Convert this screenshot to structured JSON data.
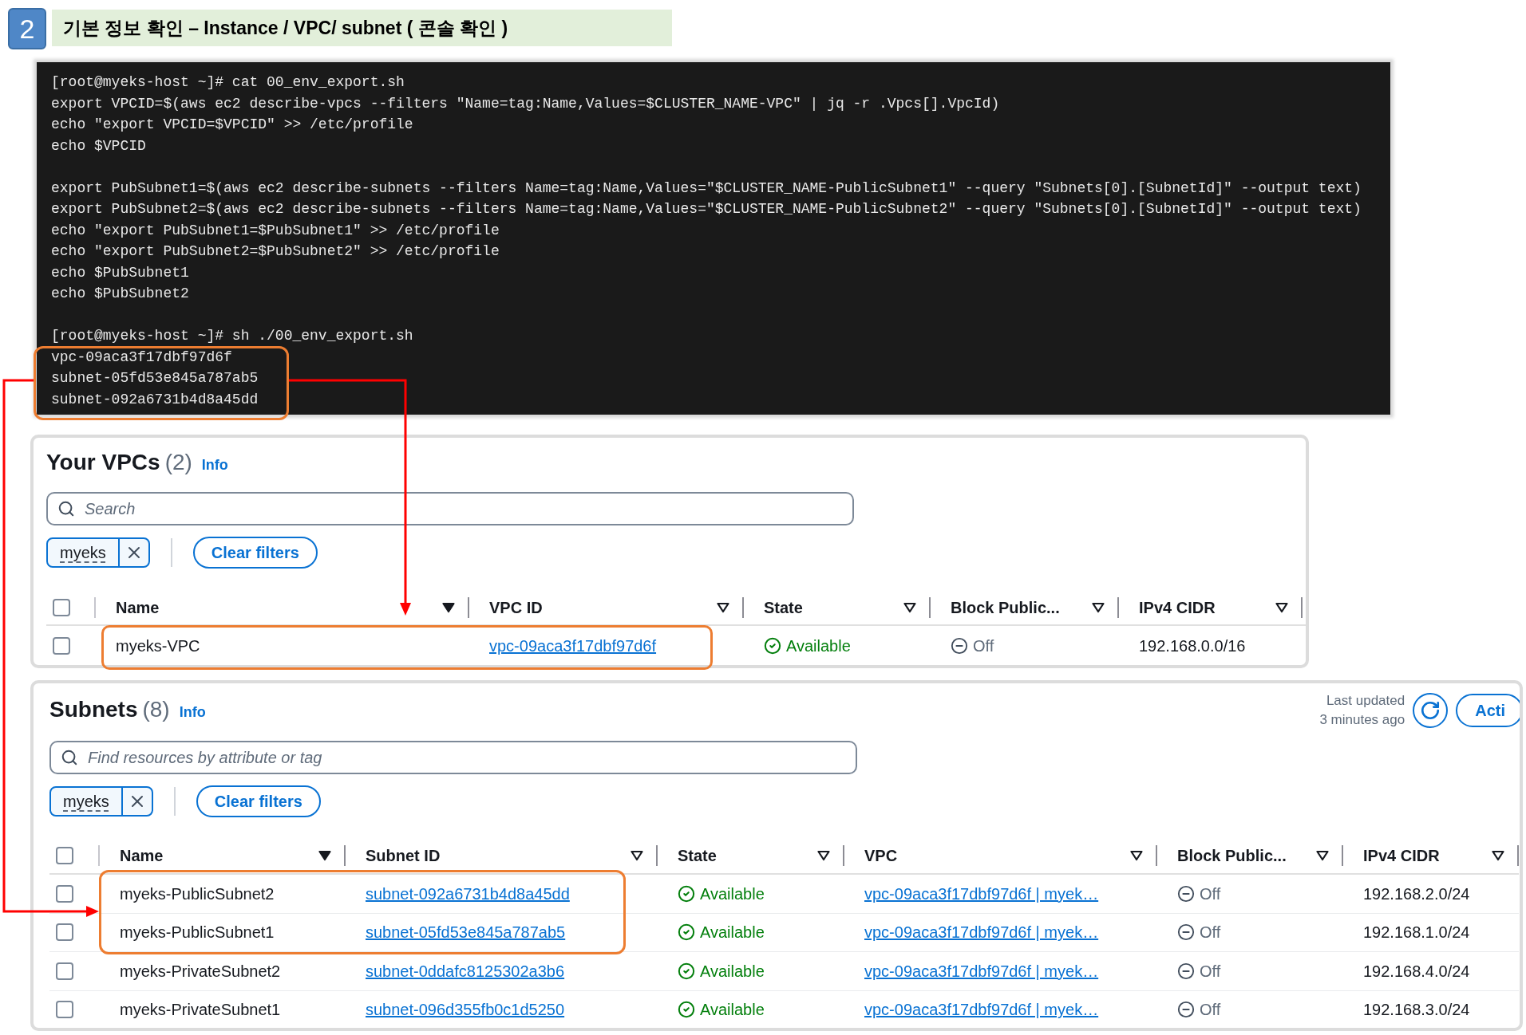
{
  "step": {
    "number": "2",
    "title": "기본 정보 확인 – Instance / VPC/ subnet ( 콘솔 확인 )"
  },
  "terminal": {
    "blocks": [
      [
        "[root@myeks-host ~]# cat 00_env_export.sh",
        "export VPCID=$(aws ec2 describe-vpcs --filters \"Name=tag:Name,Values=$CLUSTER_NAME-VPC\" | jq -r .Vpcs[].VpcId)",
        "echo \"export VPCID=$VPCID\" >> /etc/profile",
        "echo $VPCID"
      ],
      [
        "export PubSubnet1=$(aws ec2 describe-subnets --filters Name=tag:Name,Values=\"$CLUSTER_NAME-PublicSubnet1\" --query \"Subnets[0].[SubnetId]\" --output text)",
        "export PubSubnet2=$(aws ec2 describe-subnets --filters Name=tag:Name,Values=\"$CLUSTER_NAME-PublicSubnet2\" --query \"Subnets[0].[SubnetId]\" --output text)",
        "echo \"export PubSubnet1=$PubSubnet1\" >> /etc/profile",
        "echo \"export PubSubnet2=$PubSubnet2\" >> /etc/profile",
        "echo $PubSubnet1",
        "echo $PubSubnet2"
      ],
      [
        "[root@myeks-host ~]# sh ./00_env_export.sh",
        "vpc-09aca3f17dbf97d6f",
        "subnet-05fd53e845a787ab5",
        "subnet-092a6731b4d8a45dd"
      ]
    ]
  },
  "vpcs": {
    "title": "Your VPCs",
    "count": "(2)",
    "select_all_checked": false,
    "info": "Info",
    "search": {
      "placeholder": "Search"
    },
    "filter_token": "myeks",
    "clear_button": "Clear filters",
    "columns": [
      {
        "label": "Name",
        "sorted": true
      },
      {
        "label": "VPC ID",
        "sorted": false
      },
      {
        "label": "State",
        "sorted": false
      },
      {
        "label": "Block Public...",
        "sorted": false
      },
      {
        "label": "IPv4 CIDR",
        "sorted": false
      }
    ],
    "rows": [
      {
        "checked": false,
        "name": "myeks-VPC",
        "vpc_id": "vpc-09aca3f17dbf97d6f",
        "state": "Available",
        "block_public": "Off",
        "ipv4_cidr": "192.168.0.0/16"
      }
    ]
  },
  "subnets": {
    "title": "Subnets",
    "count": "(8)",
    "select_all_checked": false,
    "info": "Info",
    "last_updated": "Last updated",
    "last_updated_ago": "3 minutes ago",
    "actions_button": "Acti",
    "search": {
      "placeholder": "Find resources by attribute or tag"
    },
    "filter_token": "myeks",
    "clear_button": "Clear filters",
    "columns": [
      {
        "label": "Name",
        "sorted": true
      },
      {
        "label": "Subnet ID",
        "sorted": false
      },
      {
        "label": "State",
        "sorted": false
      },
      {
        "label": "VPC",
        "sorted": false
      },
      {
        "label": "Block Public...",
        "sorted": false
      },
      {
        "label": "IPv4 CIDR",
        "sorted": false
      }
    ],
    "rows": [
      {
        "checked": false,
        "name": "myeks-PublicSubnet2",
        "subnet_id": "subnet-092a6731b4d8a45dd",
        "state": "Available",
        "vpc": "vpc-09aca3f17dbf97d6f | myek…",
        "block_public": "Off",
        "ipv4_cidr": "192.168.2.0/24"
      },
      {
        "checked": false,
        "name": "myeks-PublicSubnet1",
        "subnet_id": "subnet-05fd53e845a787ab5",
        "state": "Available",
        "vpc": "vpc-09aca3f17dbf97d6f | myek…",
        "block_public": "Off",
        "ipv4_cidr": "192.168.1.0/24"
      },
      {
        "checked": false,
        "name": "myeks-PrivateSubnet2",
        "subnet_id": "subnet-0ddafc8125302a3b6",
        "state": "Available",
        "vpc": "vpc-09aca3f17dbf97d6f | myek…",
        "block_public": "Off",
        "ipv4_cidr": "192.168.4.0/24"
      },
      {
        "checked": false,
        "name": "myeks-PrivateSubnet1",
        "subnet_id": "subnet-096d355fb0c1d5250",
        "state": "Available",
        "vpc": "vpc-09aca3f17dbf97d6f | myek…",
        "block_public": "Off",
        "ipv4_cidr": "192.168.3.0/24"
      }
    ]
  }
}
